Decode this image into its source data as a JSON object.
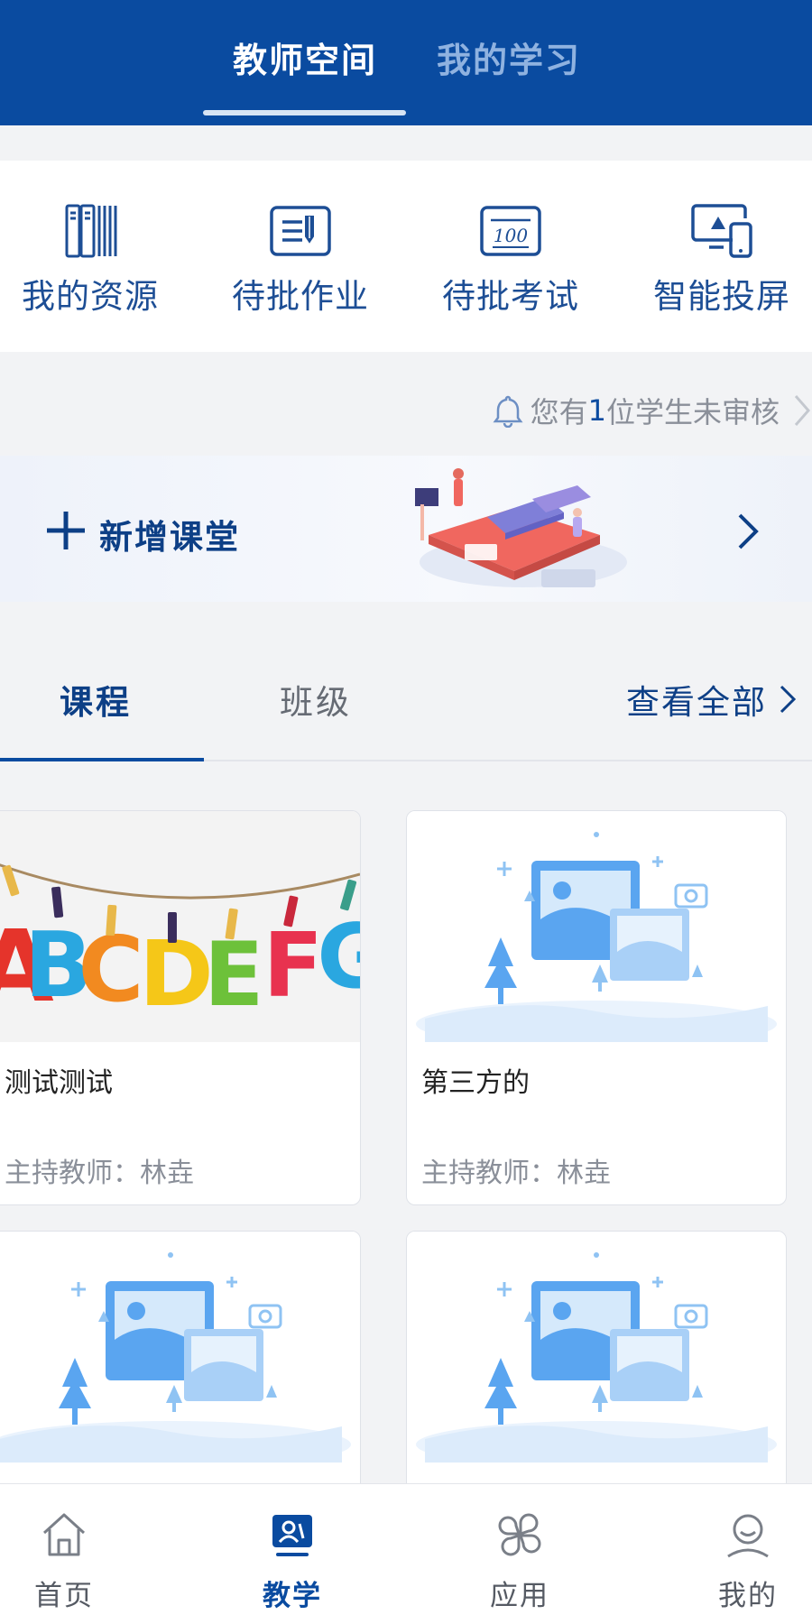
{
  "header": {
    "tabs": [
      {
        "label": "教师空间",
        "active": true
      },
      {
        "label": "我的学习",
        "active": false
      }
    ]
  },
  "quick_actions": [
    {
      "label": "我的资源",
      "icon": "books-icon"
    },
    {
      "label": "待批作业",
      "icon": "homework-icon"
    },
    {
      "label": "待批考试",
      "icon": "exam-score-icon"
    },
    {
      "label": "智能投屏",
      "icon": "screen-cast-icon"
    }
  ],
  "notice": {
    "prefix": "您有",
    "count": "1",
    "suffix": "位学生未审核"
  },
  "banner": {
    "title": "新增课堂"
  },
  "course_tabs": {
    "tabs": [
      {
        "label": "课程",
        "active": true
      },
      {
        "label": "班级",
        "active": false
      }
    ],
    "view_all": "查看全部"
  },
  "courses": [
    {
      "title": "测试测试",
      "teacher": "主持教师：林垚",
      "image": "alphabet-photo"
    },
    {
      "title": "第三方的",
      "teacher": "主持教师：林垚",
      "image": "placeholder-picture"
    },
    {
      "title": "",
      "teacher": "",
      "image": "placeholder-picture"
    },
    {
      "title": "",
      "teacher": "",
      "image": "placeholder-picture"
    }
  ],
  "bottom_nav": [
    {
      "label": "首页",
      "icon": "home-icon",
      "active": false
    },
    {
      "label": "教学",
      "icon": "teaching-icon",
      "active": true
    },
    {
      "label": "应用",
      "icon": "apps-icon",
      "active": false
    },
    {
      "label": "我的",
      "icon": "user-icon",
      "active": false
    }
  ],
  "colors": {
    "primary": "#0a4ba0",
    "accent_light": "#5aa5f0",
    "text_muted": "#8a8f99"
  }
}
